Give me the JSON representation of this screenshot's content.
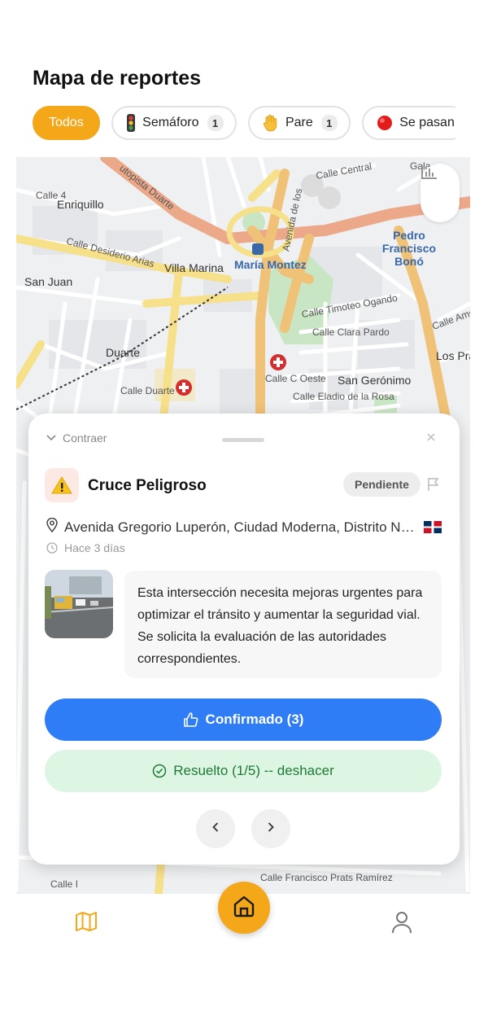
{
  "header": {
    "title": "Mapa de reportes"
  },
  "filters": [
    {
      "label": "Todos",
      "active": true,
      "icon": ""
    },
    {
      "label": "Semáforo",
      "count": "1",
      "icon": "traffic-light-icon"
    },
    {
      "label": "Pare",
      "count": "1",
      "icon": "raised-hand-icon"
    },
    {
      "label": "Se pasan",
      "icon": "red-circle-icon"
    }
  ],
  "map": {
    "labels": {
      "autopista": "utopista Duarte",
      "enriquillo": "Enriquillo",
      "calle4": "Calle 4",
      "desiderio": "Calle Desiderio Arias",
      "villamarina": "Villa Marina",
      "sanjuan": "San Juan",
      "duarte": "Duarte",
      "calleduarte": "Calle Duarte",
      "mariamontez": "María Montez",
      "pedro": "Pedro Francisco Bonó",
      "avlos": "Avenida de los",
      "timoteo": "Calle Timoteo Ogando",
      "claraPardo": "Calle Clara Pardo",
      "sangeronimo": "San Gerónimo",
      "cOeste": "Calle C Oeste",
      "eladio": "Calle Eladio de la Rosa",
      "central": "Calle Central",
      "gala": "Gala",
      "losPra": "Los Pra",
      "calleAme": "Calle Ame",
      "prats": "Calle Francisco Prats Ramírez",
      "callei": "Calle I"
    }
  },
  "card": {
    "collapse_label": "Contraer",
    "title": "Cruce Peligroso",
    "status": "Pendiente",
    "address": "Avenida Gregorio Luperón, Ciudad Moderna, Distrito Nacional",
    "time": "Hace 3 días",
    "description": "Esta intersección necesita mejoras urgentes para optimizar el tránsito y aumentar la seguridad vial. Se solicita la evaluación de las autoridades correspondientes.",
    "confirm_label": "Confirmado (3)",
    "resolved_label": "Resuelto (1/5) -- deshacer"
  },
  "colors": {
    "accent": "#f4a719",
    "primary_blue": "#2e7cf6",
    "resolved_bg": "#ddf5e3",
    "resolved_text": "#1e7a34"
  }
}
